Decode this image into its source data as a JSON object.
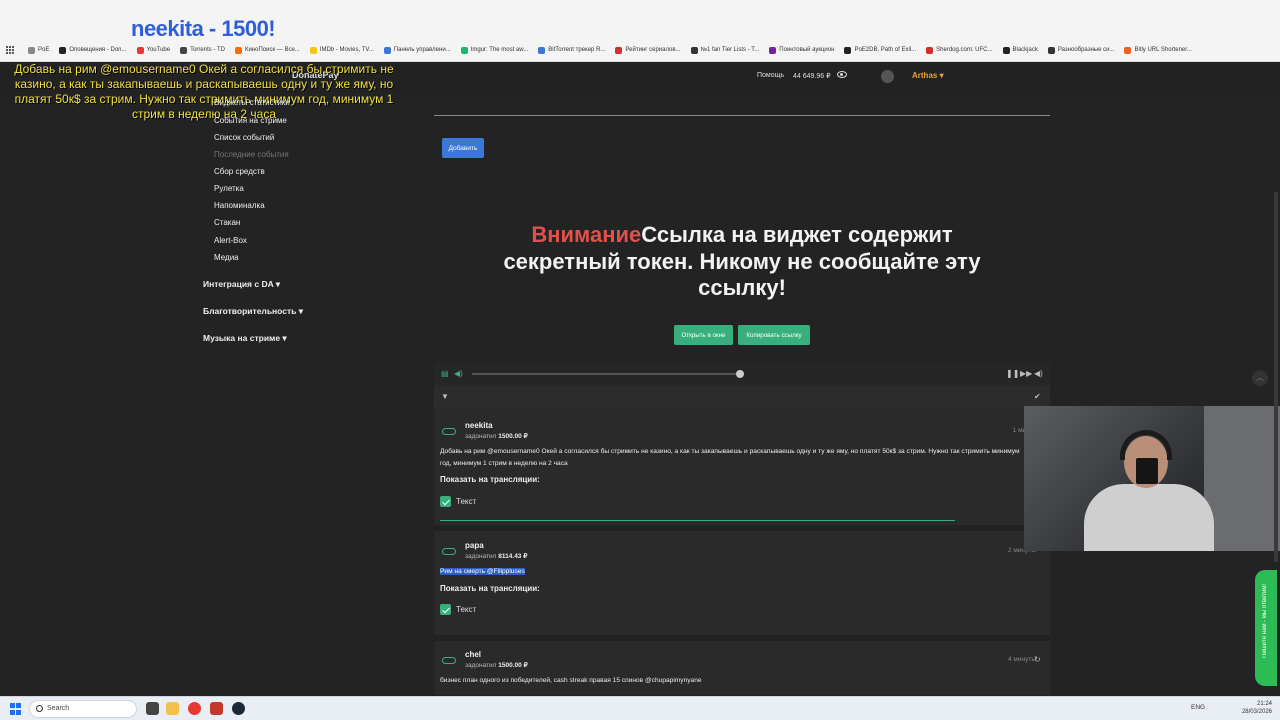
{
  "overlay_title": "neekita - 1500!",
  "bookmarks": [
    {
      "label": "PoE",
      "color": "#888888"
    },
    {
      "label": "Оповещения - Don...",
      "color": "#222222"
    },
    {
      "label": "YouTube",
      "color": "#e53935"
    },
    {
      "label": "Torrents - TD",
      "color": "#444444"
    },
    {
      "label": "КиноПоиск — Все...",
      "color": "#ff6d00"
    },
    {
      "label": "IMDb - Movies, TV...",
      "color": "#f5c518"
    },
    {
      "label": "Панель управлени...",
      "color": "#3b78d8"
    },
    {
      "label": "Imgur: The most aw...",
      "color": "#1bb76e"
    },
    {
      "label": "BitTorrent трекер R...",
      "color": "#3b78d8"
    },
    {
      "label": "Рейтинг сериалов...",
      "color": "#d32f2f"
    },
    {
      "label": "№1 fan Tier Lists - T...",
      "color": "#333333"
    },
    {
      "label": "Поинтовый аукцион",
      "color": "#7b1fa2"
    },
    {
      "label": "PoE2DB, Path of Exil...",
      "color": "#222222"
    },
    {
      "label": "Sherdog.com: UFC...",
      "color": "#d32f2f"
    },
    {
      "label": "Blackjack",
      "color": "#222222"
    },
    {
      "label": "Разнообразные си...",
      "color": "#333333"
    },
    {
      "label": "Bitly URL Shortener...",
      "color": "#ee6123"
    }
  ],
  "header": {
    "logo": "DonatePay",
    "help": "Помощь",
    "balance": "44 649.96 ₽",
    "username": "Arthas ▾"
  },
  "donation_overlay": "Добавь на рим @emousername0 Окей а согласился бы стримить не казино, а как ты закапываешь и раскапываешь одну и ту же яму, но платят 50к$ за стрим. Нужно так стримить минимум год, минимум 1 стрим в неделю на 2 часа",
  "sidebar": {
    "items": [
      {
        "label": "Виджеты статистики",
        "muted": false
      },
      {
        "label": "События на стриме",
        "muted": false
      },
      {
        "label": "Список событий",
        "muted": false
      },
      {
        "label": "Последние события",
        "muted": true
      },
      {
        "label": "Сбор средств",
        "muted": false
      },
      {
        "label": "Рулетка",
        "muted": false
      },
      {
        "label": "Напоминалка",
        "muted": false
      },
      {
        "label": "Стакан",
        "muted": false
      },
      {
        "label": "Alert-Box",
        "muted": false
      },
      {
        "label": "Медиа",
        "muted": false
      }
    ],
    "sections": [
      "Интеграция с DA ▾",
      "Благотворительность ▾",
      "Музыка на стриме ▾"
    ]
  },
  "main": {
    "add_button": "Добавить",
    "warning_red": "Внимание",
    "warning_text": "Ссылка на виджет содержит секретный токен. Никому не сообщайте эту ссылку!",
    "open_window_button": "Открыть в окне",
    "copy_link_button": "Копировать ссылку"
  },
  "events": [
    {
      "name": "neekita",
      "donated_label": "задонатил",
      "amount": "1500.00 ₽",
      "time": "1 минут",
      "message": "Добавь на рим @emousername0 Окей а согласился бы стримить не казино, а как ты закапываешь и раскапываешь одну и ту же яму, но платят 50к$ за стрим. Нужно так стримить минимум год, минимум 1 стрим в неделю на 2 часа",
      "show_label": "Показать на трансляции:",
      "checkbox_label": "Текст"
    },
    {
      "name": "papa",
      "donated_label": "задонатил",
      "amount": "8114.43 ₽",
      "time": "2 минуты",
      "message": "Рим на смерть @Filippluses",
      "show_label": "Показать на трансляции:",
      "checkbox_label": "Текст"
    },
    {
      "name": "chel",
      "donated_label": "задонатил",
      "amount": "1500.00 ₽",
      "time": "4 минуты",
      "message": "бизнес план одного из победителей, cash streak правая 15 спинов @chupapimynyane"
    }
  ],
  "side_chat": "Пишите нам - мы ответим!",
  "taskbar": {
    "search_label": "Search",
    "lang": "ENG",
    "time": "21:24",
    "date": "28/03/2026"
  }
}
